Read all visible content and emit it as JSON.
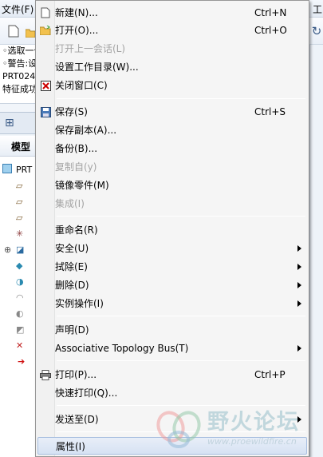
{
  "app": {
    "menubar": {
      "file_menu": "文件(F)",
      "right_fragment": "工"
    },
    "messages": [
      "◦选取一个",
      "◦警告:设",
      "PRT024",
      "特征成功"
    ],
    "model_tree_title": "模型",
    "tree_root": "PRT"
  },
  "menu": {
    "items": [
      {
        "label": "新建(N)...",
        "shortcut": "Ctrl+N",
        "icon": "new-file-icon"
      },
      {
        "label": "打开(O)...",
        "shortcut": "Ctrl+O",
        "icon": "open-folder-icon"
      },
      {
        "label": "打开上一会话(L)",
        "disabled": true
      },
      {
        "label": "设置工作目录(W)..."
      },
      {
        "label": "关闭窗口(C)",
        "icon": "close-window-icon"
      },
      {
        "label": "保存(S)",
        "shortcut": "Ctrl+S",
        "icon": "save-icon"
      },
      {
        "label": "保存副本(A)..."
      },
      {
        "label": "备份(B)..."
      },
      {
        "label": "复制自(y)",
        "disabled": true
      },
      {
        "label": "镜像零件(M)"
      },
      {
        "label": "集成(I)",
        "disabled": true
      },
      {
        "label": "重命名(R)"
      },
      {
        "label": "安全(U)",
        "submenu": true
      },
      {
        "label": "拭除(E)",
        "submenu": true
      },
      {
        "label": "删除(D)",
        "submenu": true
      },
      {
        "label": "实例操作(I)",
        "submenu": true
      },
      {
        "label": "声明(D)"
      },
      {
        "label": "Associative Topology Bus(T)",
        "submenu": true
      },
      {
        "label": "打印(P)...",
        "shortcut": "Ctrl+P",
        "icon": "printer-icon"
      },
      {
        "label": "快速打印(Q)..."
      },
      {
        "label": "发送至(D)",
        "submenu": true
      },
      {
        "label": "属性(I)",
        "highlighted": true
      }
    ]
  },
  "watermark": {
    "title": "野火论坛",
    "url": "www.proewildfire.cn"
  }
}
